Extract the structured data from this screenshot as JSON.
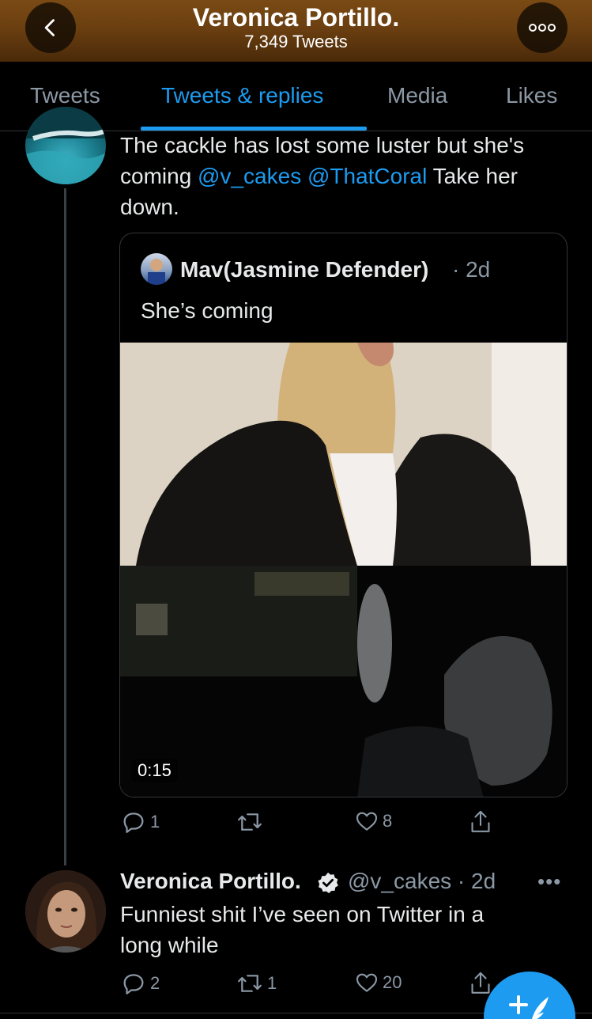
{
  "header": {
    "title": "Veronica Portillo.",
    "tweet_count": "7,349 Tweets",
    "back_icon": "chevron-left-icon",
    "more_icon": "more-horizontal-icon"
  },
  "tabs": [
    {
      "label": "Tweets",
      "active": false
    },
    {
      "label": "Tweets & replies",
      "active": true
    },
    {
      "label": "Media",
      "active": false
    },
    {
      "label": "Likes",
      "active": false
    }
  ],
  "tweet1": {
    "text_line1": "The cackle has lost some luster but she's",
    "text_line2_prefix": "coming ",
    "mention1": "@v_cakes",
    "mention2": "@ThatCoral",
    "text_line2_suffix": " Take her",
    "text_line3": "down.",
    "quote": {
      "author": "Mav(Jasmine Defender)",
      "time": "· 2d",
      "text": "She’s coming",
      "video_duration": "0:15"
    },
    "actions": {
      "replies": "1",
      "retweets": "",
      "likes": "8"
    }
  },
  "tweet2": {
    "name": "Veronica Portillo.",
    "verified": true,
    "handle_time": "@v_cakes · 2d",
    "more": "•••",
    "text_line1": "Funniest shit I’ve seen on Twitter in a",
    "text_line2": "long while",
    "actions": {
      "replies": "2",
      "retweets": "1",
      "likes": "20"
    }
  },
  "colors": {
    "accent": "#1d9bf0",
    "secondary_text": "#8b98a5",
    "primary_text": "#e7e9ea",
    "header_brown": "#6b3f10"
  },
  "fab": {
    "icon": "compose-tweet-icon"
  }
}
